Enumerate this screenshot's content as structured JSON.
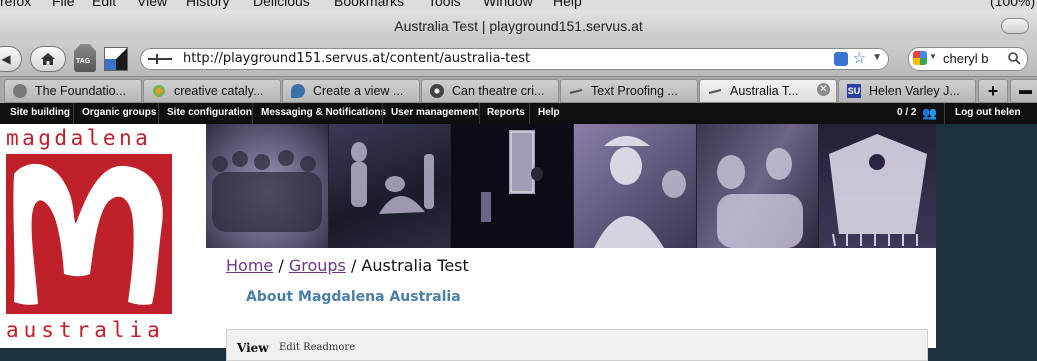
{
  "menubar": {
    "items": [
      "refox",
      "File",
      "Edit",
      "View",
      "History",
      "Delicious",
      "Bookmarks",
      "Tools",
      "Window",
      "Help"
    ],
    "right_text": "(100%)"
  },
  "window": {
    "title": "Australia Test | playground151.servus.at"
  },
  "toolbar": {
    "tag_label": "TAG",
    "url": "http://playground151.servus.at/content/australia-test",
    "search_value": "cheryl b"
  },
  "tabs": [
    {
      "label": "The Foundatio...",
      "active": false
    },
    {
      "label": "creative cataly...",
      "active": false
    },
    {
      "label": "Create a view ...",
      "active": false
    },
    {
      "label": "Can theatre cri...",
      "active": false
    },
    {
      "label": "Text Proofing ...",
      "active": false
    },
    {
      "label": "Australia T...",
      "active": true
    },
    {
      "label": "Helen Varley J...",
      "active": false
    }
  ],
  "tab_new_label": "+",
  "admin_menu": {
    "items": [
      "Site building",
      "Organic groups",
      "Site configuration",
      "Messaging & Notifications",
      "User management",
      "Reports",
      "Help"
    ],
    "user_count": "0 / 2",
    "logout": "Log out helen"
  },
  "logo": {
    "word_top": "magdalena",
    "word_bottom": "australia",
    "color": "#c0202a"
  },
  "breadcrumb": {
    "home": "Home",
    "sep1": " / ",
    "groups": "Groups",
    "sep2": " / ",
    "current": "Australia Test"
  },
  "block_title": "About Magdalena Australia",
  "tabs_local": {
    "view": "View",
    "edit": "Edit  Readmore"
  },
  "colors": {
    "admin_bg": "#0f0f0f",
    "accent_link": "#6b3a87",
    "block_title": "#4a7fa7",
    "side_bg": "#1c3140"
  }
}
